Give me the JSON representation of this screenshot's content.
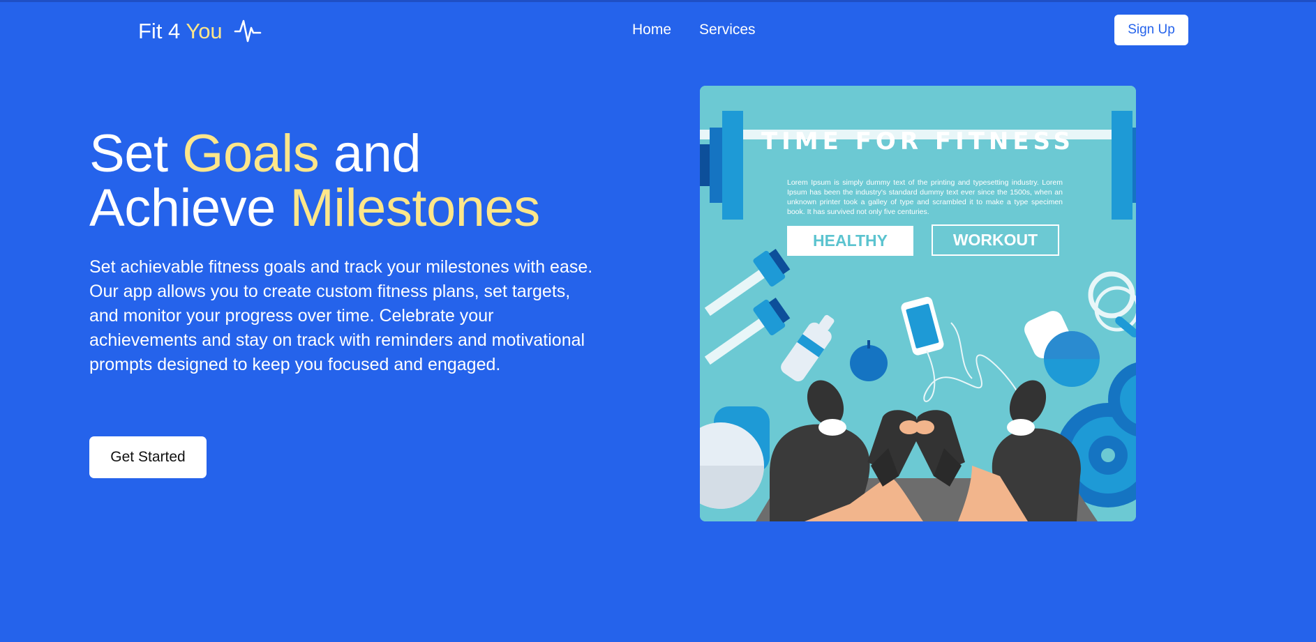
{
  "brand": {
    "part1": "Fit 4",
    "part2": "You",
    "icon": "heartbeat-icon"
  },
  "nav": {
    "items": [
      "Home",
      "Services"
    ],
    "signup_label": "Sign Up"
  },
  "hero": {
    "title": {
      "w1": "Set ",
      "w2": "Goals",
      "w3": " and",
      "w4": "Achieve ",
      "w5": "Milestones"
    },
    "description": "Set achievable fitness goals and track your milestones with ease. Our app allows you to create custom fitness plans, set targets, and monitor your progress over time. Celebrate your achievements and stay on track with reminders and motivational prompts designed to keep you focused and engaged.",
    "cta_label": "Get Started"
  },
  "illustration": {
    "title": "TIME FOR FITNESS",
    "lorem": "Lorem Ipsum is simply dummy text of the printing and typesetting industry. Lorem Ipsum has been the industry's standard dummy text ever since the 1500s, when an unknown printer took a galley of type and scrambled it to make a type specimen book. It has survived not only five centuries.",
    "tag1": "HEALTHY",
    "tag2": "WORKOUT"
  },
  "colors": {
    "background": "#2563eb",
    "accent": "#fde68a",
    "button_bg": "#ffffff",
    "poster_bg": "#6cc9d3"
  }
}
